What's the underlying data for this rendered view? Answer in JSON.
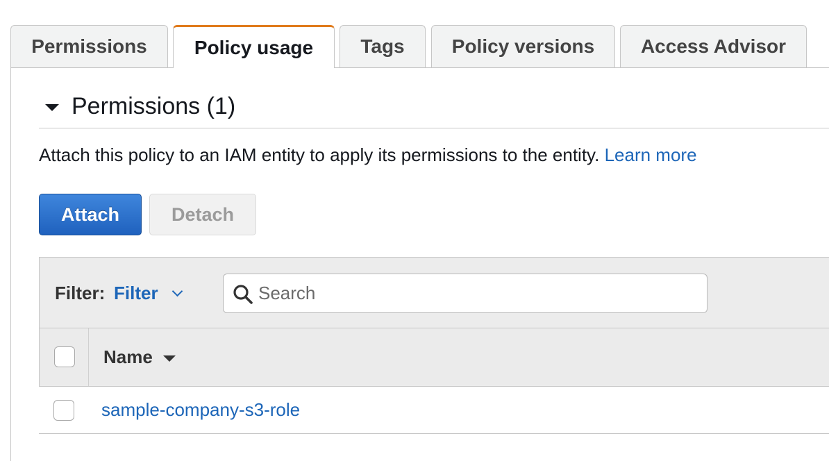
{
  "tabs": [
    {
      "label": "Permissions",
      "active": false
    },
    {
      "label": "Policy usage",
      "active": true
    },
    {
      "label": "Tags",
      "active": false
    },
    {
      "label": "Policy versions",
      "active": false
    },
    {
      "label": "Access Advisor",
      "active": false
    }
  ],
  "section": {
    "title": "Permissions (1)",
    "icon": "caret-down-icon"
  },
  "description": {
    "text": "Attach this policy to an IAM entity to apply its permissions to the entity.",
    "link_label": "Learn more"
  },
  "buttons": {
    "attach_label": "Attach",
    "detach_label": "Detach"
  },
  "filter": {
    "label": "Filter:",
    "selected": "Filter",
    "search_placeholder": "Search",
    "search_value": ""
  },
  "table": {
    "columns": [
      {
        "label": "Name",
        "sort": "descending"
      }
    ],
    "rows": [
      {
        "name": "sample-company-s3-role",
        "checked": false
      }
    ]
  },
  "colors": {
    "active_tab_accent": "#e07b1c",
    "link": "#1d66b8",
    "primary_button": "#2a6fcf"
  }
}
